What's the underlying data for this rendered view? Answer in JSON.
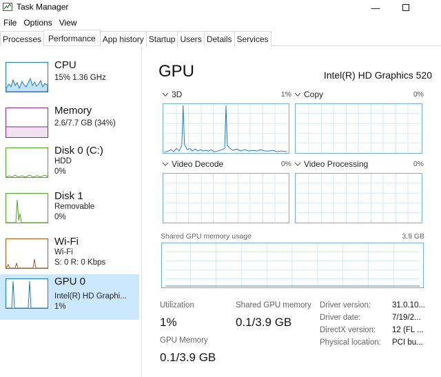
{
  "window": {
    "title": "Task Manager",
    "minimize_glyph": "—"
  },
  "menu": [
    "File",
    "Options",
    "View"
  ],
  "tabs": [
    "Processes",
    "Performance",
    "App history",
    "Startup",
    "Users",
    "Details",
    "Services"
  ],
  "active_tab": "Performance",
  "sidebar": {
    "items": [
      {
        "name": "CPU",
        "line1": "15%  1.36 GHz",
        "line2": "",
        "color": "#1e7ac4",
        "icon": "cpu-graph"
      },
      {
        "name": "Memory",
        "line1": "2.6/7.7 GB (34%)",
        "line2": "",
        "color": "#8b2a8b",
        "icon": "memory-graph"
      },
      {
        "name": "Disk 0 (C:)",
        "line1": "HDD",
        "line2": "0%",
        "color": "#4da722",
        "icon": "disk-graph"
      },
      {
        "name": "Disk 1",
        "line1": "Removable",
        "line2": "0%",
        "color": "#4da722",
        "icon": "disk-graph"
      },
      {
        "name": "Wi-Fi",
        "line1": "Wi-Fi",
        "line2": "S: 0  R: 0 Kbps",
        "color": "#a9581a",
        "icon": "network-graph"
      },
      {
        "name": "GPU 0",
        "line1": "Intel(R) HD Graphi...",
        "line2": "1%",
        "color": "#1e7ac4",
        "icon": "gpu-graph"
      }
    ],
    "selected": "GPU 0"
  },
  "main": {
    "title": "GPU",
    "model": "Intel(R) HD Graphics 520",
    "engines": [
      {
        "name": "3D",
        "percent": "1%"
      },
      {
        "name": "Copy",
        "percent": "0%"
      },
      {
        "name": "Video Decode",
        "percent": "0%"
      },
      {
        "name": "Video Processing",
        "percent": "0%"
      }
    ],
    "shared_memory": {
      "label": "Shared GPU memory usage",
      "max": "3.9 GB"
    },
    "stats": {
      "utilization_label": "Utilization",
      "utilization_value": "1%",
      "shared_label": "Shared GPU memory",
      "shared_value": "0.1/3.9 GB",
      "gpu_memory_label": "GPU Memory",
      "gpu_memory_value": "0.1/3.9 GB"
    },
    "info": [
      {
        "label": "Driver version:",
        "value": "31.0.10..."
      },
      {
        "label": "Driver date:",
        "value": "7/19/2..."
      },
      {
        "label": "DirectX version:",
        "value": "12 (FL ..."
      },
      {
        "label": "Physical location:",
        "value": "PCI bu..."
      }
    ]
  },
  "colors": {
    "graph_border": "#75b0d8",
    "graph_grid": "#d7e9f5",
    "graph_line": "#1e7ac4",
    "selection": "#cce8ff"
  }
}
